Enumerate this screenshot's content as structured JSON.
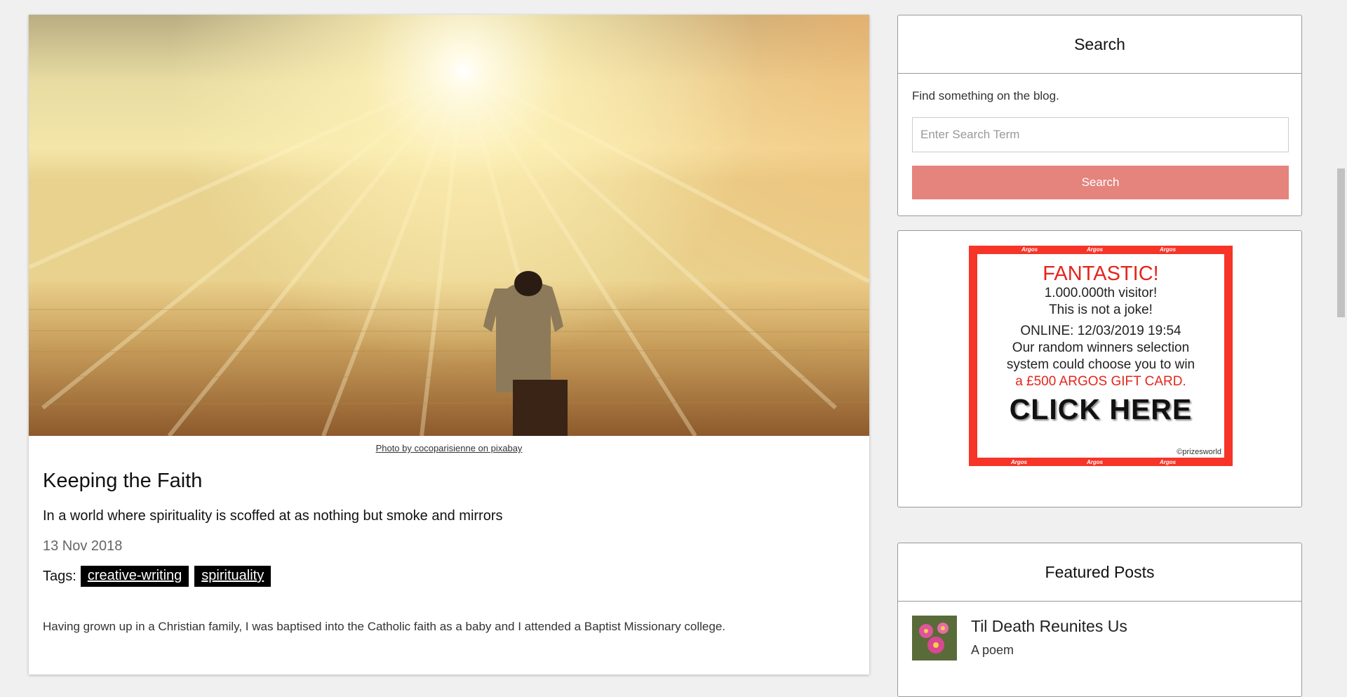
{
  "post": {
    "image_alt": "Man standing in water under sun rays",
    "caption": "Photo by cocoparisienne on pixabay",
    "title": "Keeping the Faith",
    "subtitle": "In a world where spirituality is scoffed at as nothing but smoke and mirrors",
    "date": "13 Nov 2018",
    "tags_label": "Tags:",
    "tags": [
      "creative-writing",
      "spirituality"
    ],
    "paragraph": "Having grown up in a Christian family, I was baptised into the Catholic faith as a baby and I attended a Baptist Missionary college."
  },
  "sidebar": {
    "search": {
      "title": "Search",
      "description": "Find something on the blog.",
      "placeholder": "Enter Search Term",
      "button": "Search"
    },
    "ad": {
      "brand": "Argos",
      "headline": "FANTASTIC!",
      "line1": "1.000.000th visitor!",
      "line2": "This is not a joke!",
      "online": "ONLINE: 12/03/2019 19:54",
      "line3": "Our random winners selection",
      "line4": "system could choose you to win",
      "prize": "a £500 ARGOS GIFT CARD.",
      "cta": "CLICK HERE",
      "credit": "©prizesworld"
    },
    "featured": {
      "title": "Featured Posts",
      "items": [
        {
          "title": "Til Death Reunites Us",
          "subtitle": "A poem"
        }
      ]
    }
  },
  "colors": {
    "search_button": "#e5837d",
    "ad_red": "#f63428",
    "tag_bg": "#000000"
  }
}
